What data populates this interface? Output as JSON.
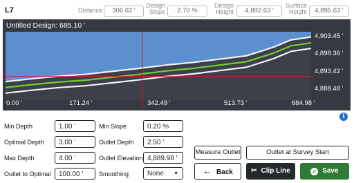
{
  "header": {
    "title": "L7",
    "stats": [
      {
        "label": "Distance",
        "value": "306.62 '"
      },
      {
        "label_line1": "Design",
        "label_line2": "Slope",
        "value": "2.70 %"
      },
      {
        "label_line1": "Design",
        "label_line2": "Height",
        "value": "4,892.63 '"
      },
      {
        "label_line1": "Surface",
        "label_line2": "Height",
        "value": "4,895.63 '"
      }
    ]
  },
  "chart": {
    "title": "Untitled Design: 685.10 '",
    "colors": {
      "panel": "#373942",
      "sky": "#5b8fd0",
      "ground": "#3d3f4a",
      "surface": "#f2f2f2",
      "design": "#6ed02c",
      "cursor": "#d02020"
    }
  },
  "chart_data": {
    "type": "line",
    "title": "Untitled Design: 685.10 '",
    "x_tick_labels": [
      "0.00 '",
      "171.24 '",
      "342.49 '",
      "513.73 '",
      "684.98 '"
    ],
    "y_tick_labels": [
      "4,903.45 '",
      "4,898.36 '",
      "4,893.42 '",
      "4,888.48 '"
    ],
    "xlim": [
      0,
      684.98
    ],
    "ylim": [
      4886.5,
      4905
    ],
    "cursor": {
      "x": 306.62,
      "y": 4892.9
    },
    "series": [
      {
        "key": "surface-upper",
        "color": "#f2f2f2",
        "x": [
          0,
          60,
          120,
          180,
          240,
          300,
          360,
          420,
          480,
          540,
          600,
          640,
          684.98
        ],
        "y": [
          4891.5,
          4892.3,
          4893.0,
          4893.5,
          4894.3,
          4895.1,
          4896.0,
          4896.7,
          4897.6,
          4898.5,
          4900.8,
          4902.8,
          4903.6
        ]
      },
      {
        "key": "design",
        "color": "#6ed02c",
        "x": [
          0,
          60,
          120,
          180,
          240,
          300,
          360,
          420,
          480,
          540,
          600,
          640,
          684.98
        ],
        "y": [
          4889.9,
          4890.7,
          4891.4,
          4891.9,
          4892.7,
          4893.5,
          4894.4,
          4895.1,
          4896.0,
          4896.9,
          4899.2,
          4901.2,
          4902.0
        ]
      },
      {
        "key": "surface-lower",
        "color": "#f2f2f2",
        "x": [
          0,
          60,
          120,
          180,
          240,
          300,
          360,
          420,
          480,
          540,
          600,
          640,
          684.98
        ],
        "y": [
          4888.4,
          4889.2,
          4889.9,
          4890.4,
          4891.2,
          4892.0,
          4892.9,
          4893.6,
          4894.5,
          4895.4,
          4897.7,
          4899.7,
          4900.5
        ]
      }
    ]
  },
  "info_icon": "i",
  "form": {
    "min_depth_label": "Min Depth",
    "min_depth_value": "1.00 '",
    "optimal_depth_label": "Optimal Depth",
    "optimal_depth_value": "3.00 '",
    "max_depth_label": "Max Depth",
    "max_depth_value": "4.00 '",
    "outlet_to_optimal_label": "Outlet to Optimal",
    "outlet_to_optimal_value": "100.00 '",
    "min_slope_label": "Min Slope",
    "min_slope_value": "0.20 %",
    "outlet_depth_label": "Outlet Depth",
    "outlet_depth_value": "2.50 '",
    "outlet_elevation_label": "Outlet Elevation",
    "outlet_elevation_value": "4,889.98 '",
    "smoothing_label": "Smoothing",
    "smoothing_value": "None"
  },
  "buttons": {
    "measure_outlet": "Measure Outlet",
    "outlet_at_survey_start": "Outlet at Survey Start",
    "back": "Back",
    "clip_line": "Clip Line",
    "save": "Save"
  }
}
